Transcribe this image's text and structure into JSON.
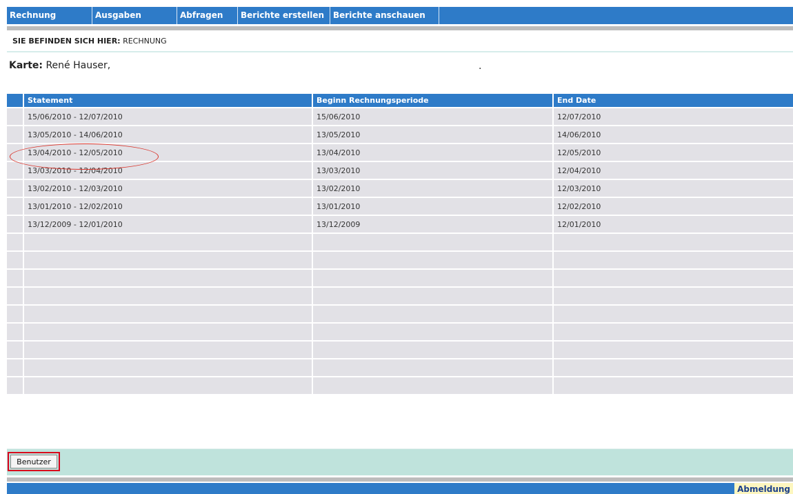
{
  "nav": {
    "items": [
      {
        "label": "Rechnung"
      },
      {
        "label": "Ausgaben"
      },
      {
        "label": "Abfragen"
      },
      {
        "label": "Berichte erstellen"
      },
      {
        "label": "Berichte anschauen"
      }
    ]
  },
  "breadcrumb": {
    "label": "SIE BEFINDEN SICH HIER:",
    "current": "RECHNUNG"
  },
  "card": {
    "label": "Karte:",
    "holder": "René Hauser,",
    "trailing": "."
  },
  "table": {
    "headers": [
      "Statement",
      "Beginn Rechnungsperiode",
      "End Date"
    ],
    "rows": [
      [
        "15/06/2010 - 12/07/2010",
        "15/06/2010",
        "12/07/2010"
      ],
      [
        "13/05/2010 - 14/06/2010",
        "13/05/2010",
        "14/06/2010"
      ],
      [
        "13/04/2010 - 12/05/2010",
        "13/04/2010",
        "12/05/2010"
      ],
      [
        "13/03/2010 - 12/04/2010",
        "13/03/2010",
        "12/04/2010"
      ],
      [
        "13/02/2010 - 12/03/2010",
        "13/02/2010",
        "12/03/2010"
      ],
      [
        "13/01/2010 - 12/02/2010",
        "13/01/2010",
        "12/02/2010"
      ],
      [
        "13/12/2009 - 12/01/2010",
        "13/12/2009",
        "12/01/2010"
      ],
      [
        "",
        "",
        ""
      ],
      [
        "",
        "",
        ""
      ],
      [
        "",
        "",
        ""
      ],
      [
        "",
        "",
        ""
      ],
      [
        "",
        "",
        ""
      ],
      [
        "",
        "",
        ""
      ],
      [
        "",
        "",
        ""
      ],
      [
        "",
        "",
        ""
      ],
      [
        "",
        "",
        ""
      ]
    ],
    "highlighted_row": 2
  },
  "user_button": {
    "label": "Benutzer"
  },
  "footer": {
    "logout_label": "Abmeldung"
  },
  "colors": {
    "nav_bg": "#2e7bc8",
    "row_bg": "#e2e1e6",
    "panel_bg": "#bfe3dc",
    "annotation": "#d9342b",
    "logout_bg": "#fdf6bf"
  }
}
